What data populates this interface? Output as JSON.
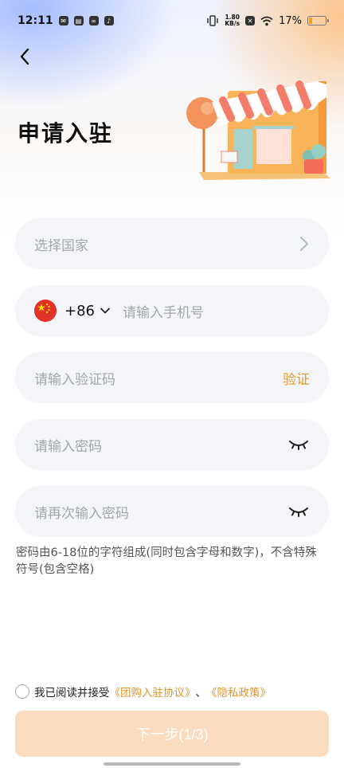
{
  "status_bar": {
    "time": "12:11",
    "net_speed_value": "1.80",
    "net_speed_unit": "KB/s",
    "battery_pct": "17%",
    "icons": [
      "mail-icon",
      "message-icon",
      "link-icon",
      "tiktok-icon",
      "vibrate-icon",
      "no-sim-icon",
      "wifi-icon",
      "battery-icon"
    ]
  },
  "header": {
    "title": "申请入驻"
  },
  "form": {
    "country": {
      "placeholder": "选择国家"
    },
    "phone": {
      "country_code": "+86",
      "placeholder": "请输入手机号"
    },
    "code": {
      "placeholder": "请输入验证码",
      "verify_label": "验证"
    },
    "password": {
      "placeholder": "请输入密码"
    },
    "password_confirm": {
      "placeholder": "请再次输入密码"
    },
    "password_tip": "密码由6-18位的字符组成(同时包含字母和数字)，不含特殊符号(包含空格)"
  },
  "agreement": {
    "prefix": "我已阅读并接受",
    "link1": "《团购入驻协议》",
    "separator": "、",
    "link2": "《隐私政策》",
    "checked": false
  },
  "next_button": {
    "label": "下一步(1/3)"
  },
  "colors": {
    "accent": "#e89a2c",
    "button_disabled": "#fbdcc0",
    "field_bg": "#f4f5f8"
  }
}
